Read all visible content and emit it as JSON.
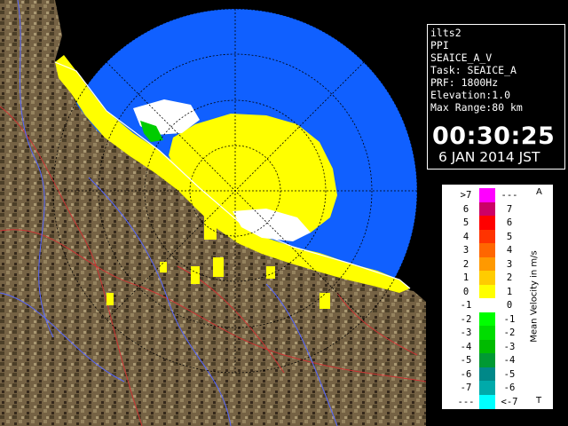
{
  "info": {
    "lines": [
      "ilts2",
      "PPI",
      "SEAICE_A_V",
      "Task: SEAICE_A",
      "PRF: 1800Hz",
      "Elevation:1.0",
      "Max Range:80 km"
    ],
    "time": "00:30:25",
    "date": "6 JAN 2014 JST"
  },
  "legend": {
    "title": "Mean Velocity in m/s",
    "top_mark": "A",
    "bottom_mark": "T",
    "rows": [
      {
        "left": ">7",
        "right": "---",
        "color": "#ff00ff"
      },
      {
        "left": "6",
        "right": "7",
        "color": "#cc0066"
      },
      {
        "left": "5",
        "right": "6",
        "color": "#ff0000"
      },
      {
        "left": "4",
        "right": "5",
        "color": "#ff3300"
      },
      {
        "left": "3",
        "right": "4",
        "color": "#ff6600"
      },
      {
        "left": "2",
        "right": "3",
        "color": "#ff9900"
      },
      {
        "left": "1",
        "right": "2",
        "color": "#ffcc00"
      },
      {
        "left": "0",
        "right": "1",
        "color": "#ffff00"
      },
      {
        "left": "-1",
        "right": "0",
        "color": "#ffffff"
      },
      {
        "left": "-2",
        "right": "-1",
        "color": "#00ff00"
      },
      {
        "left": "-3",
        "right": "-2",
        "color": "#00dd00"
      },
      {
        "left": "-4",
        "right": "-3",
        "color": "#00bb00"
      },
      {
        "left": "-5",
        "right": "-4",
        "color": "#009933"
      },
      {
        "left": "-6",
        "right": "-5",
        "color": "#008888"
      },
      {
        "left": "-7",
        "right": "-6",
        "color": "#00aaaa"
      },
      {
        "left": "---",
        "right": "<-7",
        "color": "#00ffff"
      }
    ]
  },
  "colors": {
    "sea": "#1060ff",
    "land": "#8a7450",
    "echo_positive": "#ffff00",
    "echo_near_zero": "#ffffff",
    "echo_negative": "#00cc00"
  }
}
